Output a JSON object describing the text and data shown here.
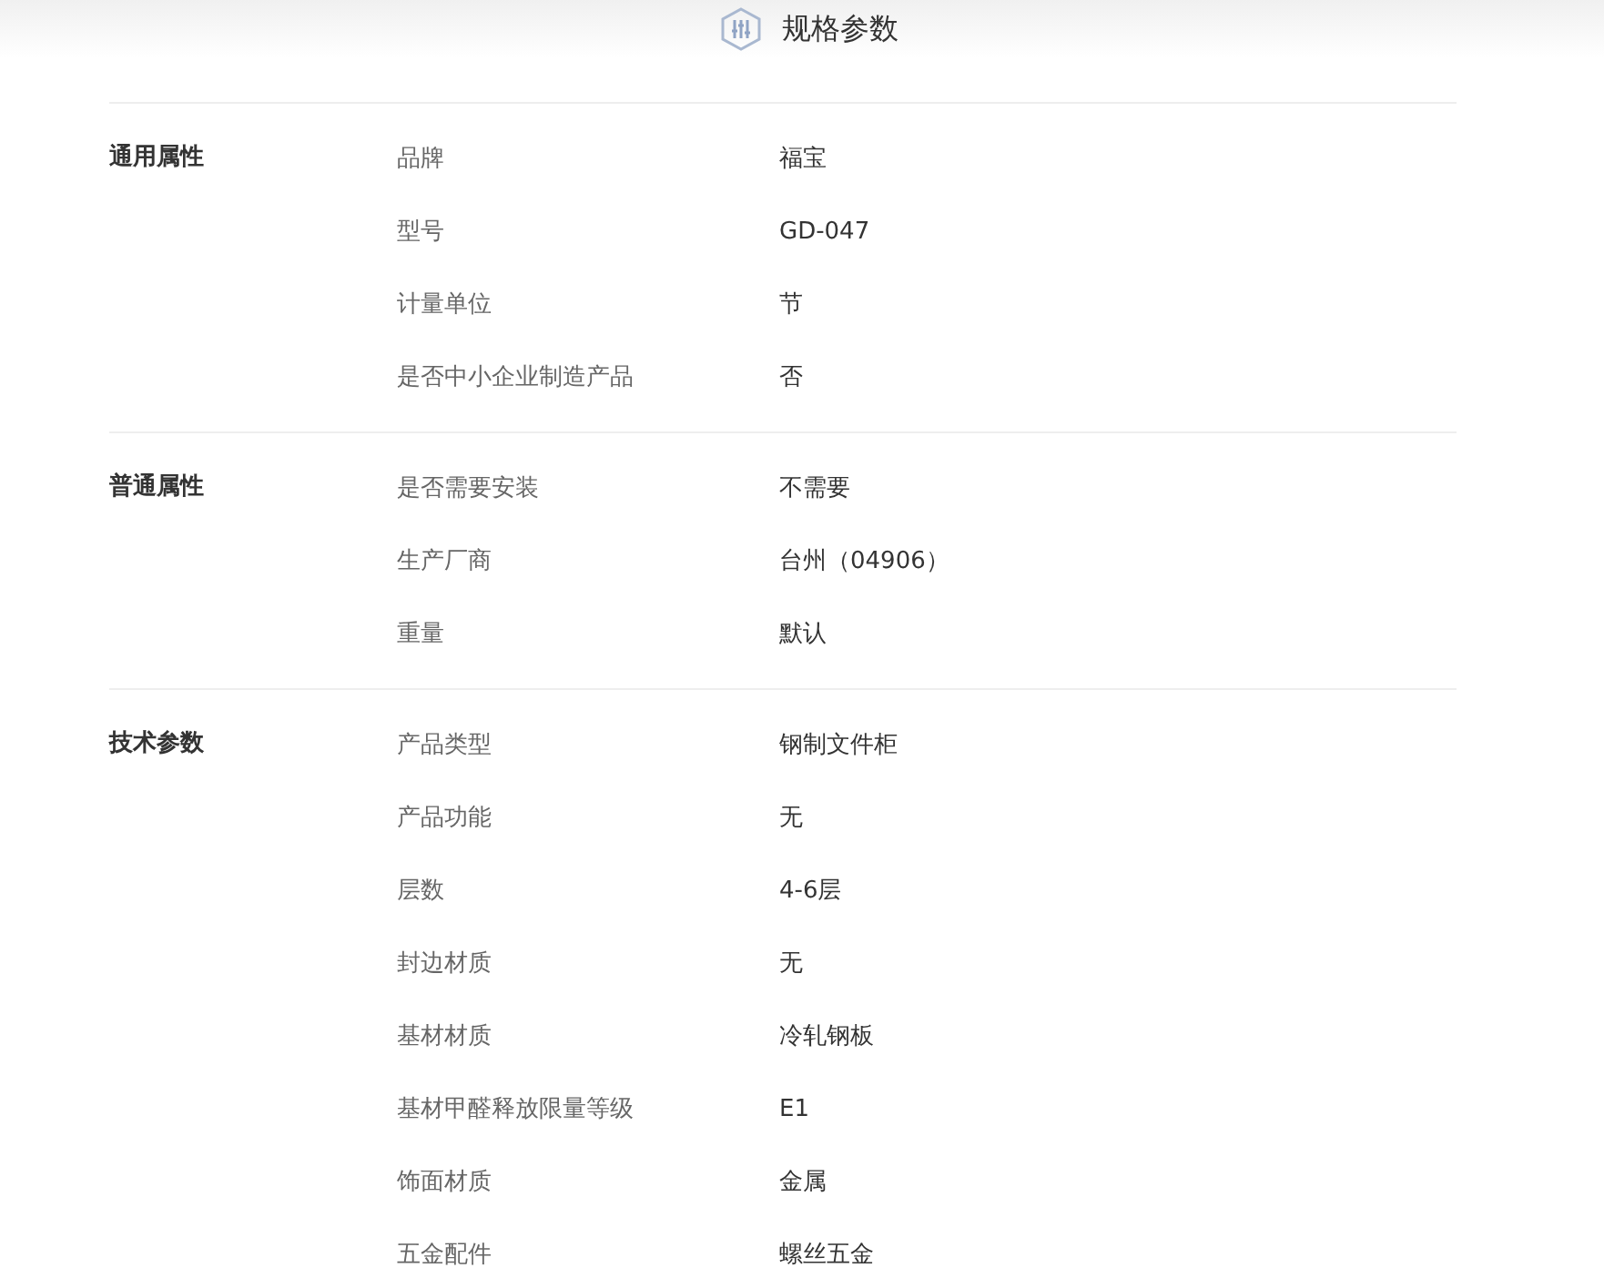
{
  "header": {
    "title": "规格参数"
  },
  "groups": [
    {
      "name": "通用属性",
      "rows": [
        {
          "key": "品牌",
          "value": "福宝"
        },
        {
          "key": "型号",
          "value": "GD-047"
        },
        {
          "key": "计量单位",
          "value": "节"
        },
        {
          "key": "是否中小企业制造产品",
          "value": "否"
        }
      ]
    },
    {
      "name": "普通属性",
      "rows": [
        {
          "key": "是否需要安装",
          "value": "不需要"
        },
        {
          "key": "生产厂商",
          "value": "台州（04906）"
        },
        {
          "key": "重量",
          "value": "默认"
        }
      ]
    },
    {
      "name": "技术参数",
      "rows": [
        {
          "key": "产品类型",
          "value": "钢制文件柜"
        },
        {
          "key": "产品功能",
          "value": "无"
        },
        {
          "key": "层数",
          "value": "4-6层"
        },
        {
          "key": "封边材质",
          "value": "无"
        },
        {
          "key": "基材材质",
          "value": "冷轧钢板"
        },
        {
          "key": "基材甲醛释放限量等级",
          "value": "E1"
        },
        {
          "key": "饰面材质",
          "value": "金属"
        },
        {
          "key": "五金配件",
          "value": "螺丝五金"
        }
      ]
    }
  ]
}
